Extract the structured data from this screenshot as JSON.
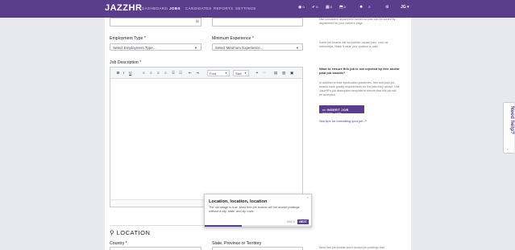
{
  "nav": {
    "logo": "JAZZHR",
    "items": [
      "DASHBOARD",
      "JOBS",
      "CANDIDATES",
      "REPORTS",
      "SETTINGS"
    ],
    "active": "JOBS",
    "icons": [
      {
        "name": "eye-icon",
        "glyph": "◉",
        "count": "0"
      },
      {
        "name": "thumbs-up-icon",
        "glyph": "✔",
        "count": "0"
      },
      {
        "name": "calendar-icon",
        "glyph": "▦",
        "count": "0"
      },
      {
        "name": "inbox-icon",
        "glyph": "⬒",
        "count": "0"
      },
      {
        "name": "lightbulb-icon",
        "glyph": "✹",
        "count": ""
      },
      {
        "name": "search-icon",
        "glyph": "⌕",
        "count": ""
      },
      {
        "name": "gear-icon",
        "glyph": "⚙",
        "count": ""
      }
    ],
    "user": "JG"
  },
  "form": {
    "employment_type_label": "Employment Type",
    "employment_type_value": "Select Employment Type...",
    "min_experience_label": "Minimum Experience",
    "min_experience_value": "Select Minimum Experience...",
    "job_description_label": "Job Description",
    "required_mark": "*",
    "toolbar": {
      "font_label": "Font",
      "size_label": "Size"
    }
  },
  "hints": {
    "top": "Use consistent department names so jobs can be sorted by department on your career's page.",
    "employment": "Some job boards will not publish unpaid jobs, such as internships. Make it clear your position is paid.",
    "free_boards_q": "Want to ensure this job is not rejected by free and/or paid job boards?",
    "syndication": "In addition to their syndication guidelines, free and paid job boards have quality requirements for the jobs they accept. Use JazzHR's job description template to ensure that this job will be accepted.",
    "insert_template": "INSERT JOB TEMPLATE",
    "tips_link": "See tips for formatting your job",
    "bottom": "Most free job boards won't accept job postings that"
  },
  "location": {
    "title": "LOCATION",
    "country_label": "Country",
    "state_label": "State, Province or Territory"
  },
  "tooltip": {
    "title": "Location, location, location",
    "body": "The old adage is true. Most free job boards will not accept postings without a city, state, and zip code.",
    "back": "BACK",
    "next": "NEXT",
    "close": "×",
    "progress": 0.35
  },
  "help": {
    "label": "Need help?",
    "arrow": "‹"
  },
  "colors": {
    "brand": "#5a3e8c",
    "background": "#e8e9ee"
  }
}
